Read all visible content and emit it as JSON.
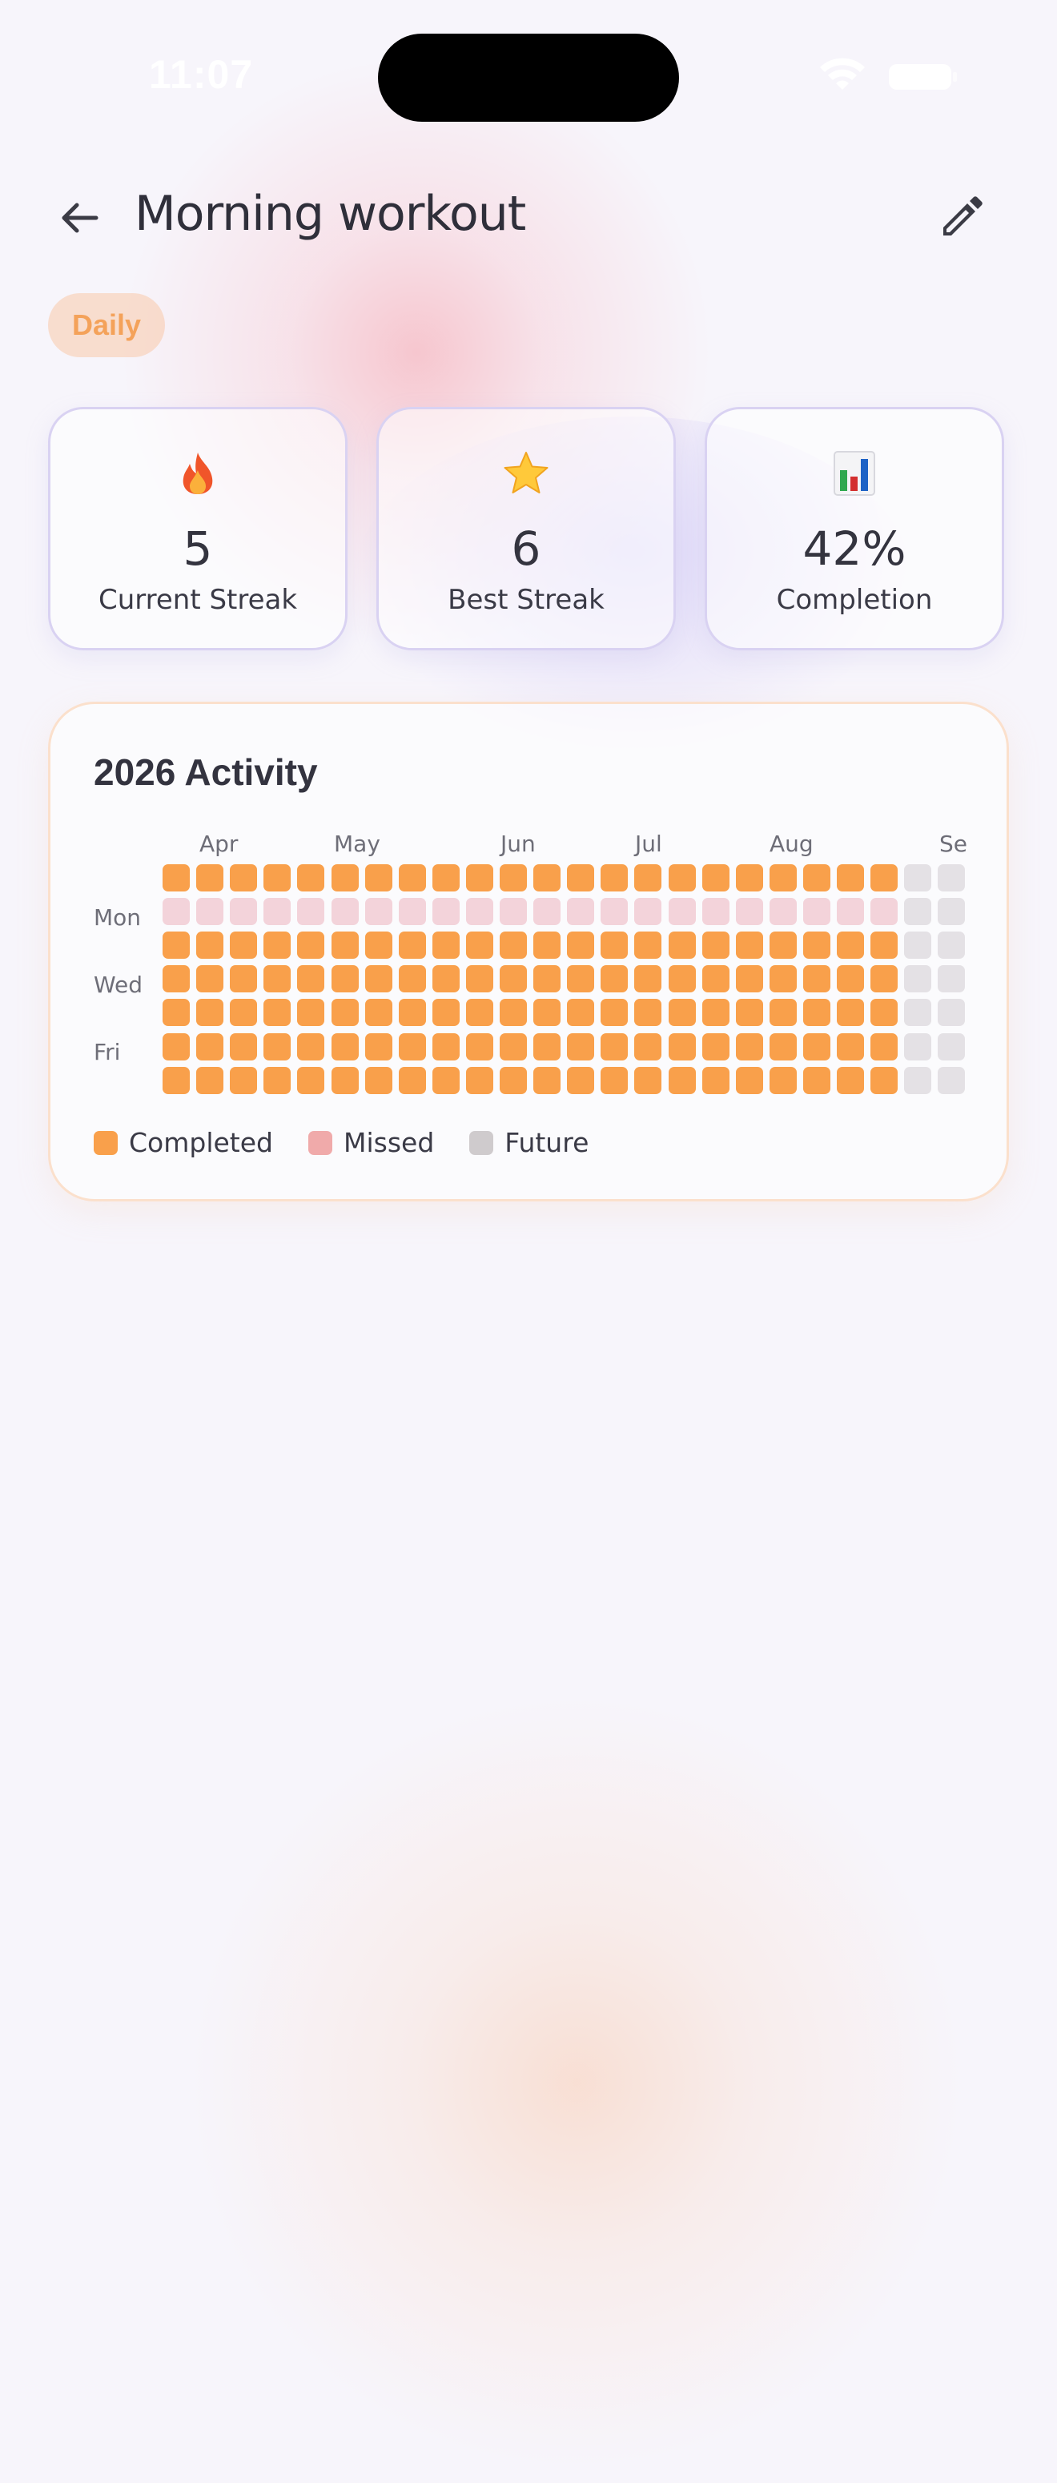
{
  "status_bar": {
    "time": "11:07"
  },
  "header": {
    "title": "Morning workout",
    "back_icon": "arrow-left-icon",
    "edit_icon": "pencil-icon"
  },
  "badge": {
    "label": "Daily"
  },
  "stats": [
    {
      "icon": "fire-icon",
      "value": "5",
      "label": "Current Streak"
    },
    {
      "icon": "star-icon",
      "value": "6",
      "label": "Best Streak"
    },
    {
      "icon": "bar-chart-icon",
      "value": "42%",
      "label": "Completion"
    }
  ],
  "activity": {
    "title": "2026 Activity",
    "months": [
      "Apr",
      "May",
      "Jun",
      "Jul",
      "Aug",
      "Se"
    ],
    "day_labels": [
      "Mon",
      "Wed",
      "Fri"
    ],
    "weeks": 24,
    "completed_weeks": 22,
    "missed_row": 1
  },
  "legend": [
    {
      "label": "Completed",
      "color": "#f9a04b"
    },
    {
      "label": "Missed",
      "color": "#f0aaaa"
    },
    {
      "label": "Future",
      "color": "#cfcbcd"
    }
  ],
  "colors": {
    "completed": "#f9a04b",
    "missed": "#f3d3da",
    "future": "#e4e1e5",
    "accent": "#f4a25a"
  }
}
